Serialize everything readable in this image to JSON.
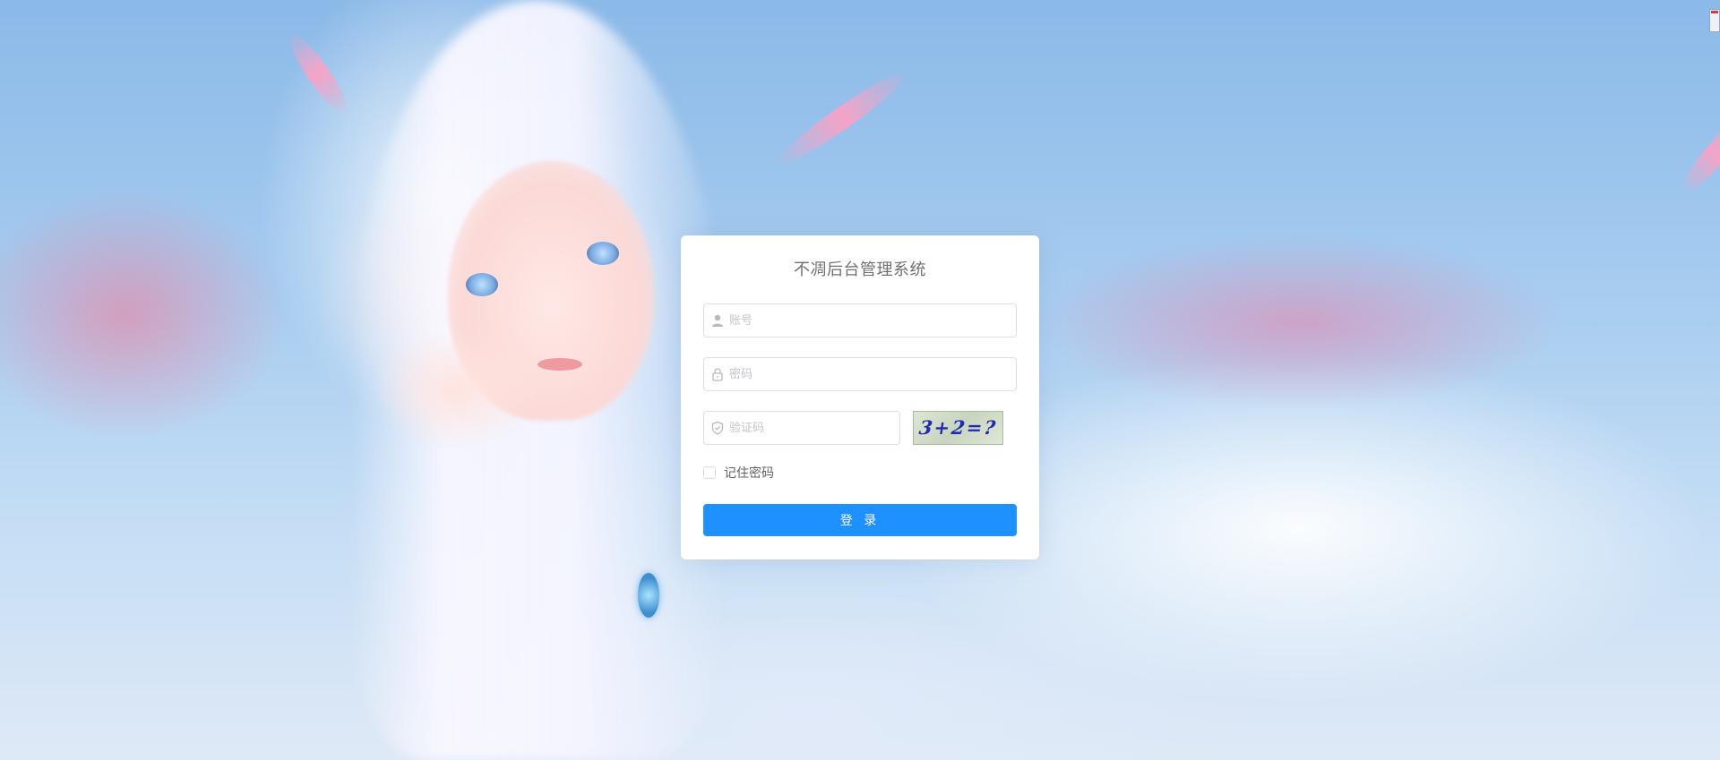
{
  "login": {
    "title": "不凋后台管理系统",
    "username_placeholder": "账号",
    "password_placeholder": "密码",
    "captcha_placeholder": "验证码",
    "captcha_image_text": "3+2=?",
    "remember_label": "记住密码",
    "submit_label": "登 录"
  },
  "icons": {
    "username": "user-icon",
    "password": "lock-icon",
    "captcha": "shield-icon",
    "corner": "document-icon"
  },
  "colors": {
    "primary_button": "#1e90ff",
    "card_background": "#ffffff",
    "title_text": "#707070",
    "placeholder_text": "#c0c4cc",
    "captcha_text": "#1c2bb0"
  }
}
